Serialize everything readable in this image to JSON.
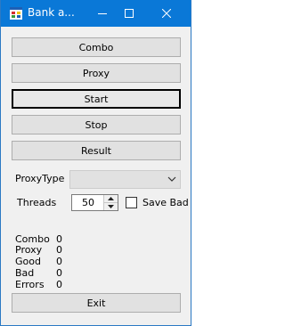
{
  "window": {
    "title": "Bank a...",
    "min_symbol": "—",
    "max_symbol": "☐",
    "close_symbol": "✕"
  },
  "buttons": {
    "combo": "Combo",
    "proxy": "Proxy",
    "start": "Start",
    "stop": "Stop",
    "result": "Result",
    "exit": "Exit"
  },
  "settings": {
    "proxy_type_label": "ProxyType",
    "proxy_type_value": "",
    "threads_label": "Threads",
    "threads_value": "50",
    "save_bad_label": "Save Bad",
    "save_bad_checked": false
  },
  "stats": [
    {
      "label": "Combo",
      "value": "0"
    },
    {
      "label": "Proxy",
      "value": "0"
    },
    {
      "label": "Good",
      "value": "0"
    },
    {
      "label": "Bad",
      "value": "0"
    },
    {
      "label": "Errors",
      "value": "0"
    }
  ]
}
